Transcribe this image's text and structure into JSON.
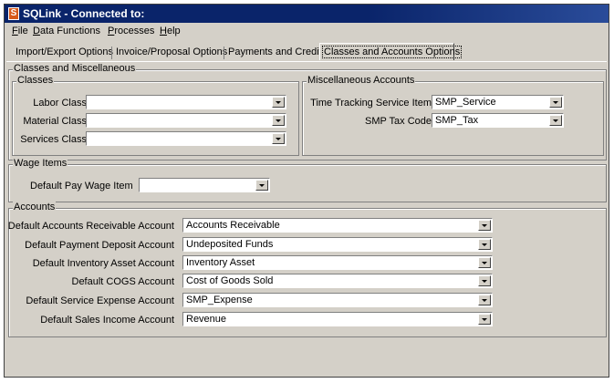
{
  "window": {
    "title": "SQLink - Connected to:",
    "icon": "app-s-icon",
    "icon_glyph": "S"
  },
  "menu": [
    {
      "pre": "",
      "key": "F",
      "post": "ile"
    },
    {
      "pre": "",
      "key": "D",
      "post": "ata Functions"
    },
    {
      "pre": "",
      "key": "P",
      "post": "rocesses"
    },
    {
      "pre": "",
      "key": "H",
      "post": "elp"
    }
  ],
  "tabs": [
    "Import/Export Options",
    "Invoice/Proposal Options",
    "Payments and Credits",
    "Classes and Accounts Options"
  ],
  "active_tab": "Classes and Accounts Options",
  "classes_misc": {
    "title": "Classes and Miscellaneous",
    "classes": {
      "title": "Classes",
      "fields": [
        {
          "label": "Labor Class",
          "value": ""
        },
        {
          "label": "Material Class",
          "value": ""
        },
        {
          "label": "Services Class",
          "value": ""
        }
      ]
    },
    "misc_accounts": {
      "title": "Miscellaneous Accounts",
      "fields": [
        {
          "label": "Time Tracking Service Item",
          "value": "SMP_Service"
        },
        {
          "label": "SMP Tax Code",
          "value": "SMP_Tax"
        }
      ]
    }
  },
  "wage_items": {
    "title": "Wage Items",
    "fields": [
      {
        "label": "Default Pay Wage Item",
        "value": ""
      }
    ]
  },
  "accounts": {
    "title": "Accounts",
    "fields": [
      {
        "label": "Default Accounts Receivable Account",
        "value": "Accounts Receivable"
      },
      {
        "label": "Default Payment Deposit Account",
        "value": "Undeposited Funds"
      },
      {
        "label": "Default Inventory Asset Account",
        "value": "Inventory Asset"
      },
      {
        "label": "Default COGS Account",
        "value": "Cost of Goods Sold"
      },
      {
        "label": "Default Service Expense Account",
        "value": "SMP_Expense"
      },
      {
        "label": "Default Sales Income Account",
        "value": "Revenue"
      }
    ]
  }
}
